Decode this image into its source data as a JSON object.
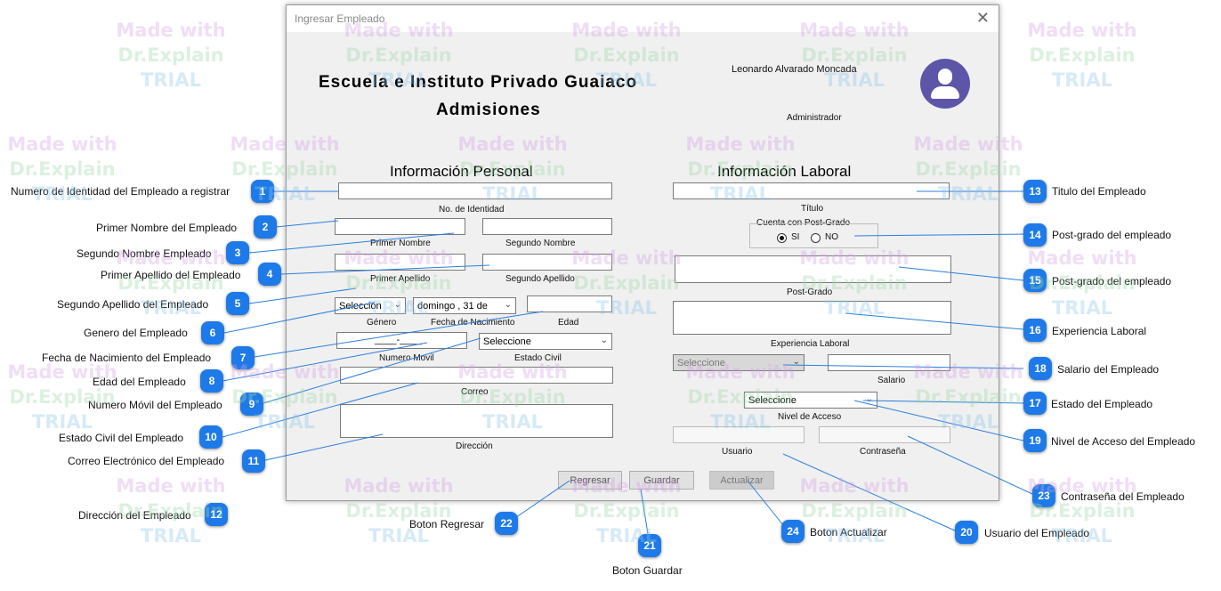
{
  "window": {
    "title": "Ingresar Empleado",
    "close_icon": "close-icon",
    "school_name": "Escuela e Instituto Privado Guaiaco",
    "subtitle": "Admisiones",
    "user_name": "Leonardo Alvarado Moncada",
    "user_role": "Administrador",
    "avatar_icon": "user-avatar-icon"
  },
  "personal": {
    "heading": "Información Personal",
    "id_label": "No. de Identidad",
    "first_name_label": "Primer Nombre",
    "second_name_label": "Segundo Nombre",
    "first_surname_label": "Primer Apellido",
    "second_surname_label": "Segundo Apellido",
    "gender_value": "Selección",
    "gender_label": "Género",
    "birthdate_value": "domingo , 31 de",
    "birthdate_label": "Fecha de Nacimiento",
    "age_label": "Edad",
    "mobile_mask": "____-____",
    "mobile_label": "Numero Movil",
    "civil_value": "Seleccione",
    "civil_label": "Estado Civil",
    "email_label": "Correo",
    "address_label": "Dirección"
  },
  "labor": {
    "heading": "Información Laboral",
    "title_label": "Título",
    "postgrad_label": "Cuenta con Post-Grado",
    "postgrad_yes": "SI",
    "postgrad_no": "NO",
    "postgrad_field_label": "Post-Grado",
    "experience_label": "Experiencia Laboral",
    "status_value": "Seleccione",
    "salary_label": "Salario",
    "access_value": "Seleccione",
    "access_label": "Nivel de Acceso",
    "user_label": "Usuario",
    "password_label": "Contraseña"
  },
  "buttons": {
    "back": "Regresar",
    "save": "Guardar",
    "update": "Actualizar"
  },
  "callouts": [
    {
      "n": "1",
      "text": "Numero de Identidad del Empleado a registrar"
    },
    {
      "n": "2",
      "text": "Primer Nombre del Empleado"
    },
    {
      "n": "3",
      "text": "Segundo Nombre Empleado"
    },
    {
      "n": "4",
      "text": "Primer Apellido del Empleado"
    },
    {
      "n": "5",
      "text": "Segundo Apellido del Empleado"
    },
    {
      "n": "6",
      "text": "Genero del Empleado"
    },
    {
      "n": "7",
      "text": "Fecha de Nacimiento del Empleado"
    },
    {
      "n": "8",
      "text": "Edad del Empleado"
    },
    {
      "n": "9",
      "text": "Numero Móvil del Empleado"
    },
    {
      "n": "10",
      "text": "Estado Civil del Empleado"
    },
    {
      "n": "11",
      "text": "Correo Electrónico del Empleado"
    },
    {
      "n": "12",
      "text": "Dirección del Empleado"
    },
    {
      "n": "13",
      "text": "Titulo del Empleado"
    },
    {
      "n": "14",
      "text": "Post-grado del empleado"
    },
    {
      "n": "15",
      "text": "Post-grado del empleado"
    },
    {
      "n": "16",
      "text": "Experiencia Laboral"
    },
    {
      "n": "17",
      "text": "Estado del Empleado"
    },
    {
      "n": "18",
      "text": "Salario del Empleado"
    },
    {
      "n": "19",
      "text": "Nivel de Acceso del Empleado"
    },
    {
      "n": "20",
      "text": "Usuario del Empleado"
    },
    {
      "n": "21",
      "text": "Boton Guardar"
    },
    {
      "n": "22",
      "text": "Boton Regresar"
    },
    {
      "n": "23",
      "text": "Contraseña del Empleado"
    },
    {
      "n": "24",
      "text": "Boton Actualizar"
    }
  ],
  "watermark": {
    "line1": "Made with",
    "line2": "Dr.Explain",
    "line3": "TRIAL"
  },
  "colors": {
    "badge": "#1e7ae8",
    "avatar": "#5d56a8",
    "leader_line": "#2a7fdc"
  }
}
